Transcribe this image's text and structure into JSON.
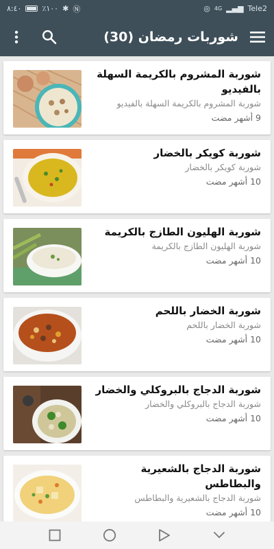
{
  "status_bar": {
    "time": "٨:٤٠",
    "battery_pct": "٪١٠٠",
    "carrier": "Tele2",
    "network_type": "4G"
  },
  "app_bar": {
    "title": "شوربات رمضان (30)"
  },
  "recipes": [
    {
      "title": "شوربة المشروم بالكريمة السهلة بالفيديو",
      "subtitle": "شوربة المشروم بالكريمة السهلة بالفيديو",
      "date": "9 أشهر مضت"
    },
    {
      "title": "شوربة كويكر بالخضار",
      "subtitle": "شوربة كويكر بالخضار",
      "date": "10 أشهر مضت"
    },
    {
      "title": "شوربة الهليون الطازج بالكريمة",
      "subtitle": "شوربة الهليون الطازج بالكريمة",
      "date": "10 أشهر مضت"
    },
    {
      "title": "شوربة الخضار باللحم",
      "subtitle": "شوربة الخضار باللحم",
      "date": "10 أشهر مضت"
    },
    {
      "title": "شوربة الدجاج بالبروكلي والخضار",
      "subtitle": "شوربة الدجاج بالبروكلي والخضار",
      "date": "10 أشهر مضت"
    },
    {
      "title": "شوربة الدجاج بالشعيرية والبطاطس",
      "subtitle": "شوربة الدجاج بالشعيرية والبطاطس",
      "date": "10 أشهر مضت"
    }
  ],
  "colors": {
    "app_bar": "#3e4f5a",
    "background": "#e9e9e9",
    "card": "#ffffff"
  }
}
